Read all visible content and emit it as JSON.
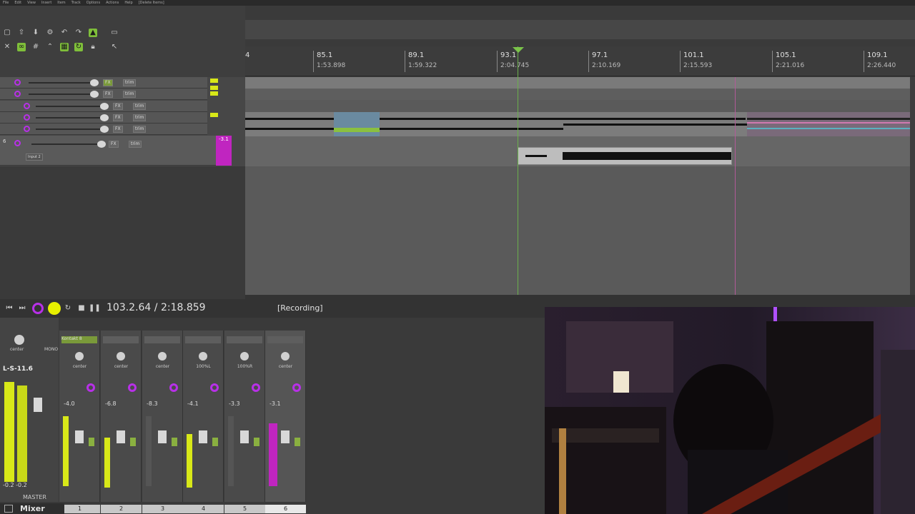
{
  "menu": [
    "File",
    "Edit",
    "View",
    "Insert",
    "Item",
    "Track",
    "Options",
    "Actions",
    "Help",
    "[Delete Items]"
  ],
  "ruler": {
    "markers": [
      {
        "bar": "85.1",
        "time": "1:53.898"
      },
      {
        "bar": "89.1",
        "time": "1:59.322"
      },
      {
        "bar": "93.1",
        "time": "2:04.745"
      },
      {
        "bar": "97.1",
        "time": "2:10.169"
      },
      {
        "bar": "101.1",
        "time": "2:15.593"
      },
      {
        "bar": "105.1",
        "time": "2:21.016"
      },
      {
        "bar": "109.1",
        "time": "2:26.440"
      }
    ],
    "left_partial": "4"
  },
  "tracks": [
    {
      "label": "trim"
    },
    {
      "label": "trim"
    },
    {
      "label": "trim"
    },
    {
      "label": "trim"
    },
    {
      "label": "trim"
    },
    {
      "label": "trim",
      "num": "6",
      "input": "Input 2",
      "meter_value": "-3.1"
    }
  ],
  "transport": {
    "position": "103.2.64 / 2:18.859",
    "status": "[Recording]"
  },
  "mixer": {
    "master_value": "L-S-11.6",
    "master_pan": "center",
    "master_mono": "MONO",
    "master_label": "MASTER",
    "master_bottom": "-0.2 -0.2",
    "strips": [
      {
        "num": "1",
        "fx": "Kontakt 8",
        "pan": "center",
        "vol": "-4.0"
      },
      {
        "num": "2",
        "fx": "",
        "pan": "center",
        "vol": "-6.8"
      },
      {
        "num": "3",
        "fx": "",
        "pan": "center",
        "vol": "-8.3"
      },
      {
        "num": "4",
        "fx": "",
        "pan": "100%L",
        "vol": "-4.1"
      },
      {
        "num": "5",
        "fx": "",
        "pan": "100%R",
        "vol": "-3.3"
      },
      {
        "num": "6",
        "fx": "",
        "pan": "center",
        "vol": "-3.1"
      }
    ],
    "tab_label": "Mixer"
  },
  "colors": {
    "accent": "#b830e8",
    "meter": "#d8e818",
    "playhead": "#6ab04c"
  }
}
